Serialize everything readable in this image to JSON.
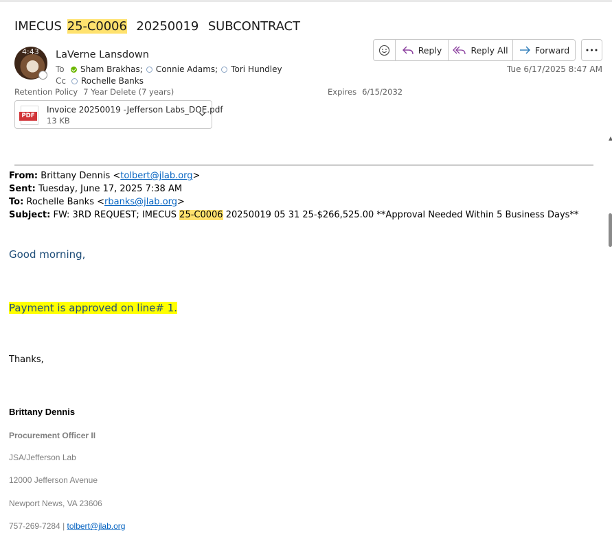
{
  "email": {
    "subject_parts": [
      "IMECUS",
      "25-C0006",
      "20250019",
      "SUBCONTRACT"
    ],
    "sender": "LaVerne Lansdown",
    "avatar_time": "4:43",
    "to_label": "To",
    "cc_label": "Cc",
    "to": [
      {
        "name": "Sham Brakhas;",
        "status": "available"
      },
      {
        "name": "Connie Adams;",
        "status": "unknown"
      },
      {
        "name": "Tori Hundley",
        "status": "unknown"
      }
    ],
    "cc": [
      {
        "name": "Rochelle Banks",
        "status": "unknown"
      }
    ],
    "retention_label": "Retention Policy",
    "retention_value": "7 Year Delete (7 years)",
    "expires_label": "Expires",
    "expires_value": "6/15/2032",
    "date": "Tue 6/17/2025 8:47 AM",
    "attachment": {
      "name": "Invoice 20250019 -Jefferson Labs_DOE.pdf",
      "size": "13 KB",
      "badge": "PDF"
    }
  },
  "actions": {
    "reply": "Reply",
    "reply_all": "Reply All",
    "forward": "Forward"
  },
  "body": {
    "from_label": "From:",
    "from_name": "Brittany Dennis <",
    "from_email": "tolbert@jlab.org",
    "from_close": ">",
    "sent_label": "Sent:",
    "sent_value": "Tuesday, June 17, 2025 7:38 AM",
    "to_label": "To:",
    "to_name": "Rochelle Banks <",
    "to_email": "rbanks@jlab.org",
    "to_close": ">",
    "subject_label": "Subject:",
    "subject_pre": "FW: 3RD REQUEST; IMECUS",
    "subject_hl": "25-C0006",
    "subject_post": "20250019 05 31 25-$266,525.00 **Approval Needed Within 5 Business Days**",
    "greeting": "Good morning,",
    "approval": "Payment is approved on line# 1.",
    "thanks": "Thanks,",
    "signature": {
      "name": "Brittany Dennis",
      "title": "Procurement Officer II",
      "org": "JSA/Jefferson Lab",
      "address1": "12000 Jefferson Avenue",
      "address2": "Newport News, VA 23606",
      "phone": "757-269-7284 |",
      "email": "tolbert@jlab.org"
    }
  },
  "colors": {
    "highlight_yellow": "#ffe26e",
    "bright_yellow": "#ffff00",
    "link_blue": "#0563c1",
    "body_blue": "#1f4e79",
    "presence_green": "#6bb700",
    "reply_purple": "#8a3e9e",
    "forward_blue": "#2a7ab8",
    "pdf_red": "#d13438"
  }
}
